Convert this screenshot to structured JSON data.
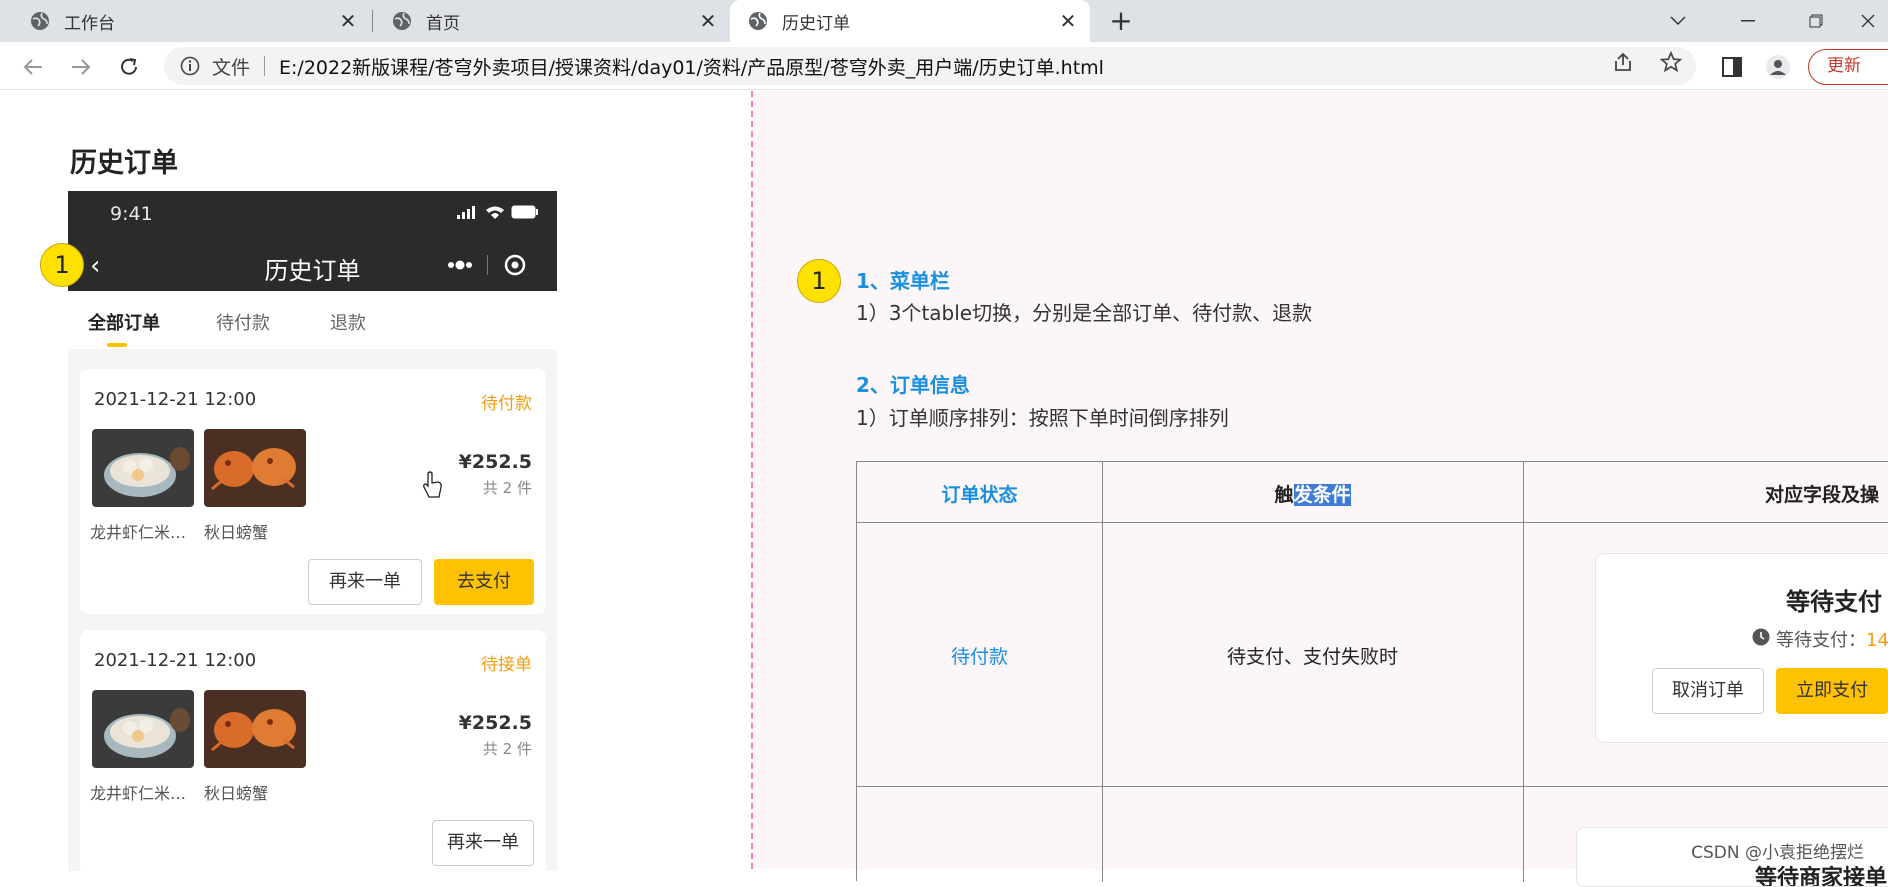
{
  "browser": {
    "tabs": [
      {
        "title": "工作台",
        "active": false
      },
      {
        "title": "首页",
        "active": false
      },
      {
        "title": "历史订单",
        "active": true
      }
    ],
    "address": {
      "scheme_label": "文件",
      "url": "E:/2022新版课程/苍穹外卖项目/授课资料/day01/资料/产品原型/苍穹外卖_用户端/历史订单.html"
    },
    "update_label": "更新"
  },
  "page": {
    "title": "历史订单"
  },
  "phone": {
    "time": "9:41",
    "nav_title": "历史订单",
    "tabs": [
      "全部订单",
      "待付款",
      "退款"
    ],
    "orders": [
      {
        "date": "2021-12-21 12:00",
        "status": "待付款",
        "items": [
          "龙井虾仁米…",
          "秋日螃蟹"
        ],
        "price": "¥252.5",
        "count": "共 2 件",
        "buttons": [
          "再来一单",
          "去支付"
        ]
      },
      {
        "date": "2021-12-21 12:00",
        "status": "待接单",
        "items": [
          "龙井虾仁米…",
          "秋日螃蟹"
        ],
        "price": "¥252.5",
        "count": "共 2 件",
        "buttons": [
          "再来一单"
        ]
      }
    ]
  },
  "badges": {
    "left": "1",
    "right": "1"
  },
  "doc": {
    "section1_title": "1、菜单栏",
    "section1_line": "1）3个table切换，分别是全部订单、待付款、退款",
    "section2_title": "2、订单信息",
    "section2_line": "1）订单顺序排列：按照下单时间倒序排列",
    "table": {
      "headers": [
        "订单状态",
        "触",
        "发条件",
        "对应字段及操"
      ],
      "row1": {
        "status": "待付款",
        "condition": "待支付、支付失败时",
        "preview_title": "等待支付",
        "preview_wait": "等待支付：",
        "preview_time": "14:",
        "preview_cancel": "取消订单",
        "preview_pay": "立即支付"
      },
      "row2_preview": "等待商家接单"
    }
  },
  "watermark": "CSDN @小袁拒绝摆烂",
  "colors": {
    "accent": "#ffc200",
    "link": "#1a8fe0",
    "status_orange": "#f39c12"
  }
}
